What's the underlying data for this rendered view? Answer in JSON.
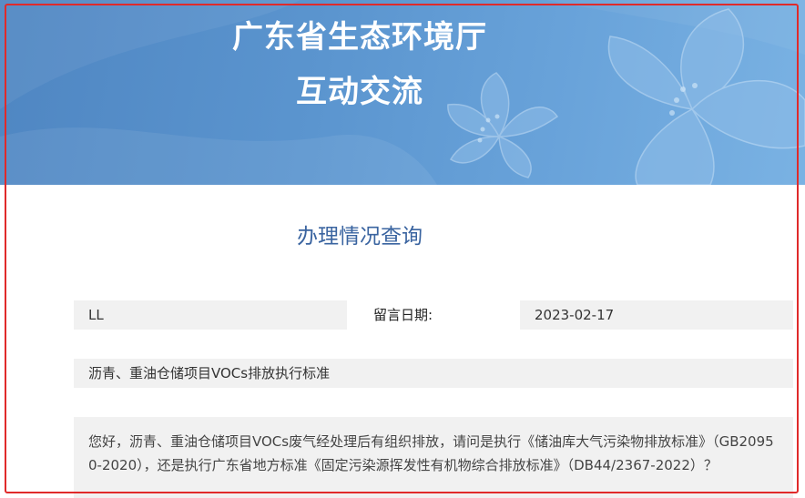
{
  "header": {
    "title_line1": "广东省生态环境厅",
    "title_line2": "互动交流",
    "flower_icon": "flower-icon"
  },
  "section": {
    "title": "办理情况查询"
  },
  "message": {
    "name": "LL",
    "date_label": "留言日期:",
    "date": "2023-02-17",
    "subject": "沥青、重油仓储项目VOCs排放执行标准",
    "content": "您好，沥青、重油仓储项目VOCs废气经处理后有组织排放，请问是执行《储油库大气污染物排放标准》（GB20950-2020），还是执行广东省地方标准《固定污染源挥发性有机物综合排放标准》（DB44/2367-2022）？"
  },
  "colors": {
    "banner": "#5b95cf",
    "title": "#3a64a0",
    "field_bg": "#f1f1f1",
    "frame": "#e02a2a"
  }
}
